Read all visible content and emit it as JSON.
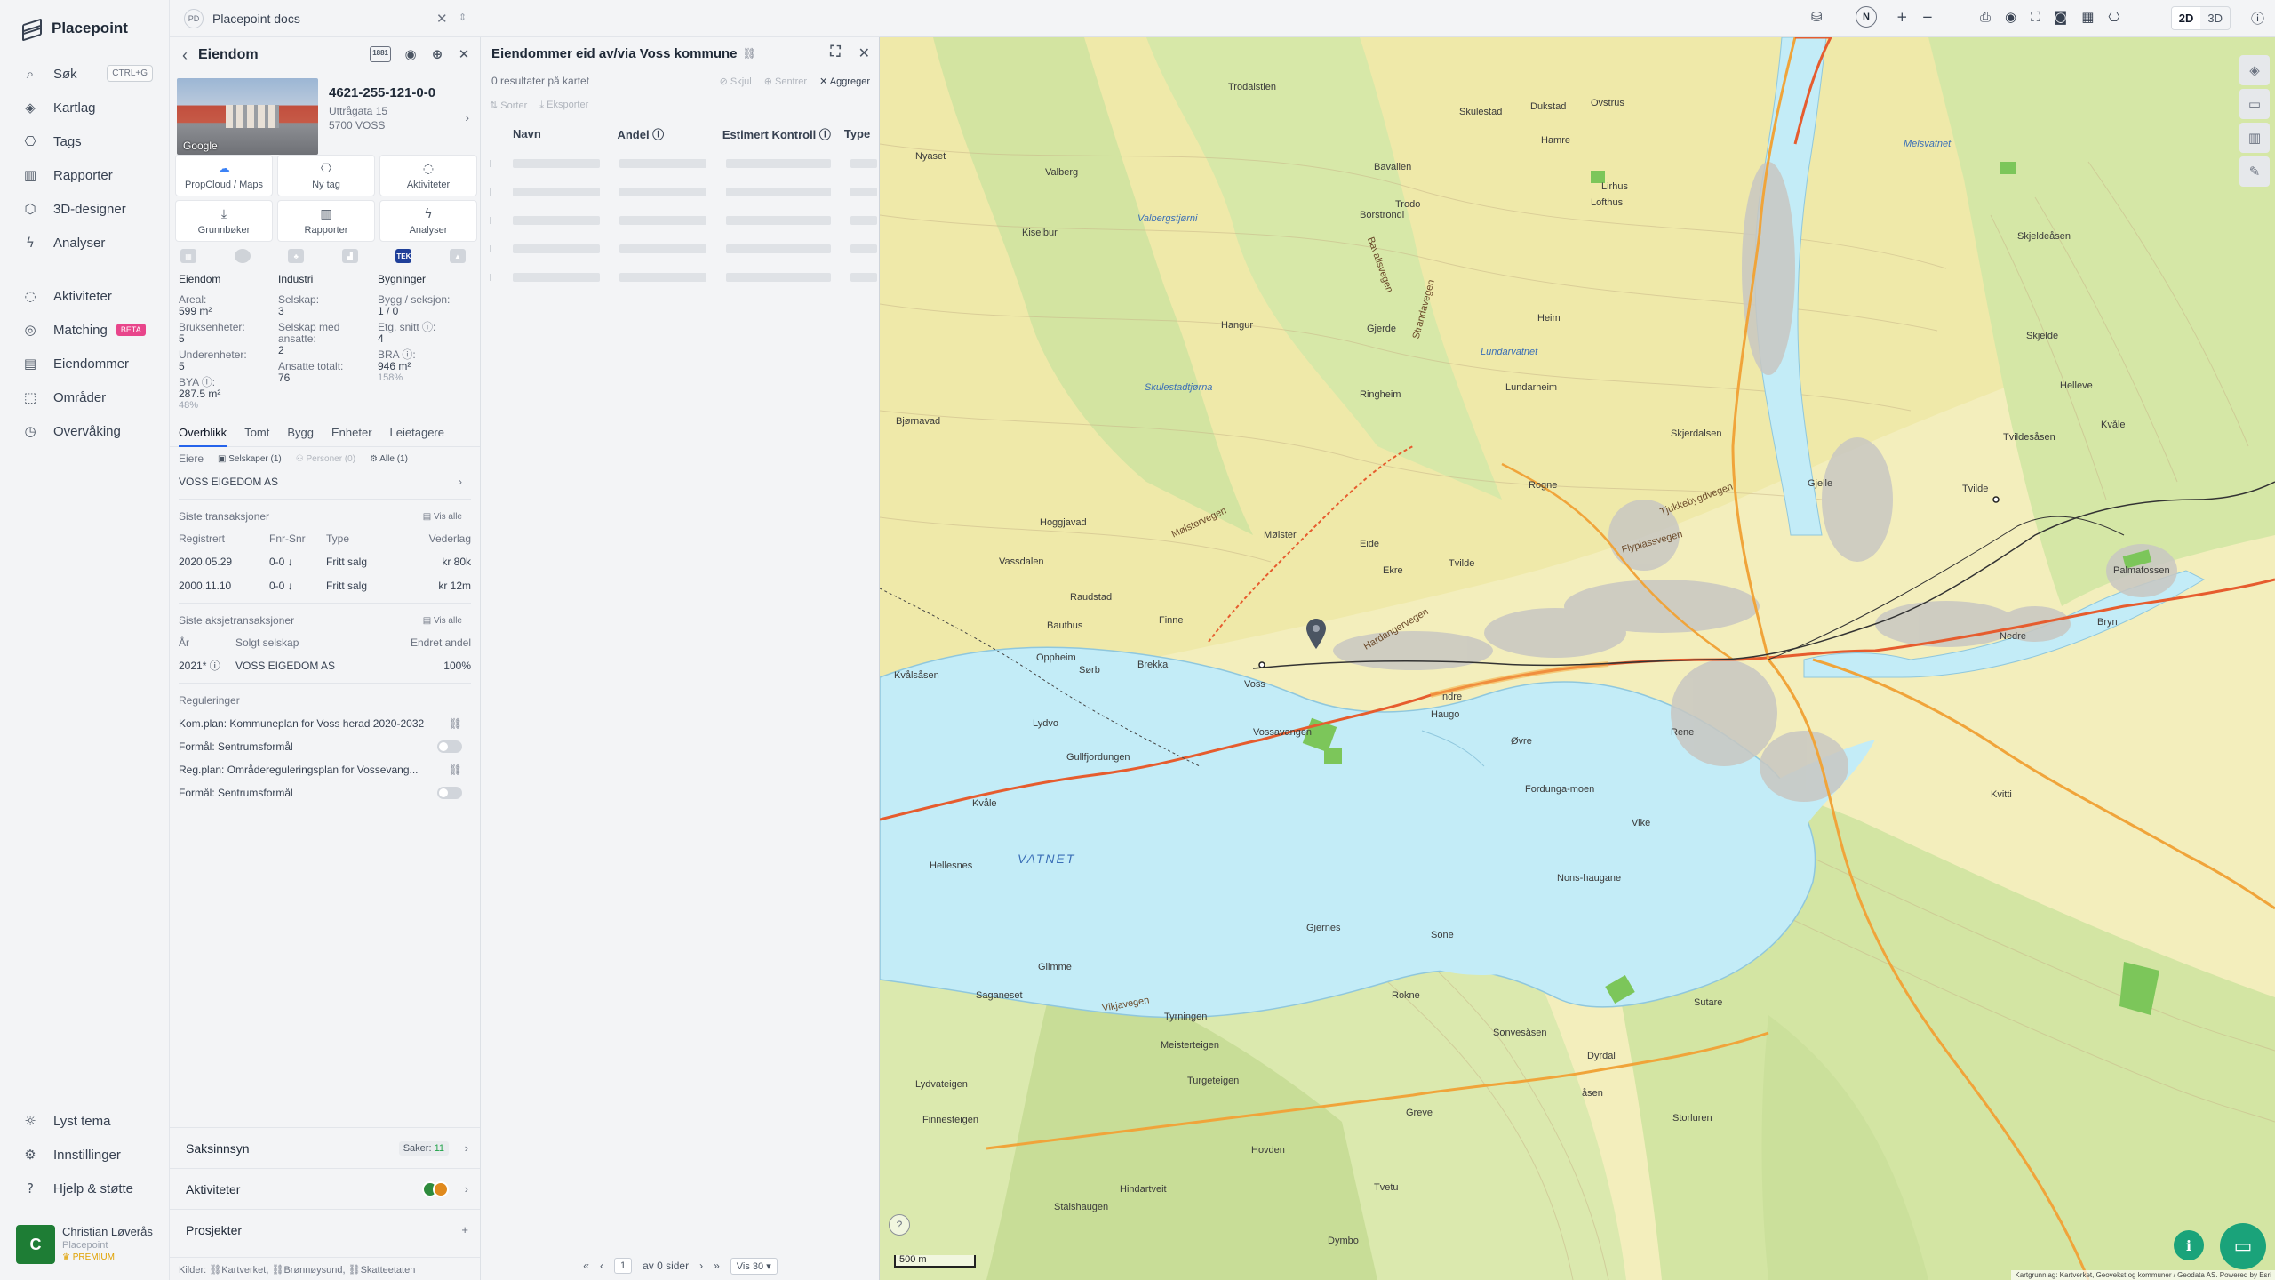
{
  "app": {
    "name": "Placepoint",
    "workspace_initials": "PD",
    "workspace": "Placepoint docs"
  },
  "nav": {
    "items": [
      {
        "label": "Søk",
        "icon": "search-icon",
        "shortcut": "CTRL+G"
      },
      {
        "label": "Kartlag",
        "icon": "layers-icon"
      },
      {
        "label": "Tags",
        "icon": "bookmark-icon"
      },
      {
        "label": "Rapporter",
        "icon": "chart-icon"
      },
      {
        "label": "3D-designer",
        "icon": "cube-icon"
      },
      {
        "label": "Analyser",
        "icon": "bolt-icon"
      }
    ],
    "items2": [
      {
        "label": "Aktiviteter",
        "icon": "chat-icon"
      },
      {
        "label": "Matching",
        "icon": "target-icon",
        "badge": "BETA"
      },
      {
        "label": "Eiendommer",
        "icon": "building-icon"
      },
      {
        "label": "Områder",
        "icon": "area-icon"
      },
      {
        "label": "Overvåking",
        "icon": "clock-icon"
      }
    ],
    "bottom": [
      {
        "label": "Lyst tema",
        "icon": "sun-icon"
      },
      {
        "label": "Innstillinger",
        "icon": "gear-icon"
      },
      {
        "label": "Hjelp & støtte",
        "icon": "help-icon"
      }
    ],
    "user": {
      "initial": "C",
      "name": "Christian Løverås",
      "org": "Placepoint",
      "plan": "PREMIUM"
    }
  },
  "property": {
    "header": "Eiendom",
    "badge": "1881",
    "id": "4621-255-121-0-0",
    "address1": "Uttrågata 15",
    "address2": "5700 VOSS",
    "photo_label": "Google",
    "actions": [
      "PropCloud / Maps",
      "Ny tag",
      "Aktiviteter",
      "Grunnbøker",
      "Rapporter",
      "Analyser"
    ],
    "source_tek": "TEK",
    "stats": {
      "eiendom": {
        "head": "Eiendom",
        "areal_lbl": "Areal:",
        "areal": "599 m²",
        "bruks_lbl": "Bruksenheter:",
        "bruks": "5",
        "under_lbl": "Underenheter:",
        "under": "5",
        "bya_lbl": "BYA ⓘ:",
        "bya": "287.5 m²",
        "bya_pct": "48%"
      },
      "industri": {
        "head": "Industri",
        "selskap_lbl": "Selskap:",
        "selskap": "3",
        "ansatte_lbl": "Selskap med ansatte:",
        "ansatte": "2",
        "total_lbl": "Ansatte totalt:",
        "total": "76"
      },
      "bygninger": {
        "head": "Bygninger",
        "bygg_lbl": "Bygg / seksjon:",
        "bygg": "1 / 0",
        "etg_lbl": "Etg. snitt ⓘ:",
        "etg": "4",
        "bra_lbl": "BRA ⓘ:",
        "bra": "946 m²",
        "bra_pct": "158%"
      }
    },
    "tabs": [
      "Overblikk",
      "Tomt",
      "Bygg",
      "Enheter",
      "Leietagere"
    ],
    "owners": {
      "label": "Eiere",
      "f1": "Selskaper (1)",
      "f2": "Personer (0)",
      "f3": "Alle (1)",
      "owner": "VOSS EIGEDOM AS"
    },
    "transactions": {
      "label": "Siste transaksjoner",
      "see_all": "Vis alle",
      "headers": [
        "Registrert",
        "Fnr-Snr",
        "Type",
        "Vederlag"
      ],
      "rows": [
        [
          "2020.05.29",
          "0-0 ↓",
          "Fritt salg",
          "kr 80k"
        ],
        [
          "2000.11.10",
          "0-0 ↓",
          "Fritt salg",
          "kr 12m"
        ]
      ]
    },
    "share_tx": {
      "label": "Siste aksjetransaksjoner",
      "see_all": "Vis alle",
      "headers": [
        "År",
        "Solgt selskap",
        "Endret andel"
      ],
      "rows": [
        [
          "2021* ⓘ",
          "VOSS EIGEDOM AS",
          "100%"
        ]
      ]
    },
    "regulations": {
      "label": "Reguleringer",
      "items": [
        {
          "text": "Kom.plan: Kommuneplan for Voss herad 2020-2032",
          "sub": "Formål: Sentrumsformål"
        },
        {
          "text": "Reg.plan: Områdereguleringsplan for Vossevang...",
          "sub": "Formål: Sentrumsformål"
        }
      ]
    },
    "accordion": {
      "saksinnsyn": "Saksinnsyn",
      "saker_lbl": "Saker:",
      "saker": "11",
      "aktiviteter": "Aktiviteter",
      "prosjekter": "Prosjekter"
    },
    "sources_label": "Kilder:",
    "sources": [
      "Kartverket,",
      "Brønnøysund,",
      "Skatteetaten"
    ]
  },
  "list": {
    "title": "Eiendommer eid av/via Voss kommune",
    "results": "0 resultater på kartet",
    "hide": "Skjul",
    "center": "Sentrer",
    "aggregate": "Aggreger",
    "sort": "Sorter",
    "export": "Eksporter",
    "columns": [
      "Navn",
      "Andel ⓘ",
      "Estimert Kontroll ⓘ",
      "Type"
    ],
    "pager": {
      "page": "1",
      "of": "av 0 sider",
      "per": "Vis 30"
    }
  },
  "map": {
    "mode_2d": "2D",
    "mode_3d": "3D",
    "north": "N",
    "scale": "500 m",
    "credit": "Kartgrunnlag: Kartverket, Geovekst og kommuner / Geodata AS. Powered by Esri",
    "labels": {
      "voss": "Voss",
      "vatnet": "VATNET",
      "vossavangen": "Vossavangen",
      "gullfjordungen": "Gullfjordungen",
      "helleseter": "Hellesnes",
      "skulestad": "Skulestad",
      "dukstad": "Dukstad",
      "ovstrus": "Ovstrus",
      "bavallen": "Bavallen",
      "borstrondi": "Borstrondi",
      "lundarheim": "Lundarheim",
      "ringheim": "Ringheim",
      "haugo": "Haugo",
      "indre": "Indre",
      "ovre": "Øvre",
      "rene": "Rene",
      "vikjavegen": "Vikjavegen",
      "glimme": "Glimme",
      "saganeset": "Saganeset",
      "rokne": "Rokne",
      "sonvesasen": "Sonvesåsen",
      "dyrvo": "Dymbo",
      "hovden": "Hovden",
      "hindartveit": "Hindartveit",
      "greve": "Greve",
      "rindane": "Ringheim",
      "moistervegen": "Mølstervegen",
      "hardangervegen": "Hardangervegen",
      "strandavegen": "Strandavegen",
      "flyplassvegen": "Flyplassvegen",
      "tjukkebygdvegen": "Tjukkebygdvegen",
      "bavallsvegen": "Bavallsvegen",
      "kvale": "Kvåle",
      "nyaset": "Nyaset",
      "valberg": "Valberg",
      "kiselbor": "Kiselbur",
      "bjornavad": "Bjørnavad",
      "hoggiavad": "Hoggjavad",
      "vassdalen": "Vassdalen",
      "raudstad": "Raudstad",
      "bauthus": "Bauthus",
      "oppheim": "Oppheim",
      "kvalsasen": "Kvålsåsen",
      "lydvo": "Lydvo",
      "sarb": "Sørb",
      "finne": "Finne",
      "brekke": "Brekka",
      "lundarheim2": "Lundarheim",
      "helleve": "Helleve",
      "kvale2": "Kvåle",
      "tvildesasen": "Tvildesåsen",
      "tvilde": "Tvilde",
      "palmafossen": "Palmafossen",
      "nedre": "Nedre",
      "bryn": "Bryn",
      "sone": "Sone",
      "gjernes": "Gjernes",
      "tyrningen": "Tyrningen",
      "meisterteigen": "Meisterteigen",
      "turgeteigen": "Turgeteigen",
      "lydvateigen": "Lydvateigen",
      "finnesteigen": "Finnesteigen",
      "stalsaugen": "Stalshaugen",
      "tvetu": "Tvetu",
      "storluren": "Storluren",
      "sutare": "Sutare",
      "dyrdal": "Dyrdal",
      "asen": "åsen",
      "nonshaugane": "Nons-haugane",
      "fordungamoen": "Fordunga-moen",
      "vike": "Vike",
      "trodo": "Trodo",
      "gjerde": "Gjerde",
      "hanguir": "Hangur",
      "skipet": "Skjelde",
      "trodalstien": "Trodalstien",
      "melsvatnet": "Melsvatnet",
      "sutaretjorna": "Skulestadtjørna",
      "tvildeviken": "Lundarvatnet",
      "hamre": "Hamre",
      "lirhus": "Lirhus",
      "lofthus": "Lofthus",
      "hesjasen": "Heim",
      "valbergstjorni": "Valbergstjørni",
      "eide": "Eide",
      "ekre": "Ekre",
      "moster": "Mølster",
      "vakerasen": "Skjerdalsen",
      "blokka": "Gjelle",
      "tvilde2": "Tvilde",
      "vikja2": "Vikjavegen",
      "rogne": "Rogne",
      "kvitti": "Kvitti",
      "skjeldeasen": "Skjeldeåsen"
    }
  }
}
